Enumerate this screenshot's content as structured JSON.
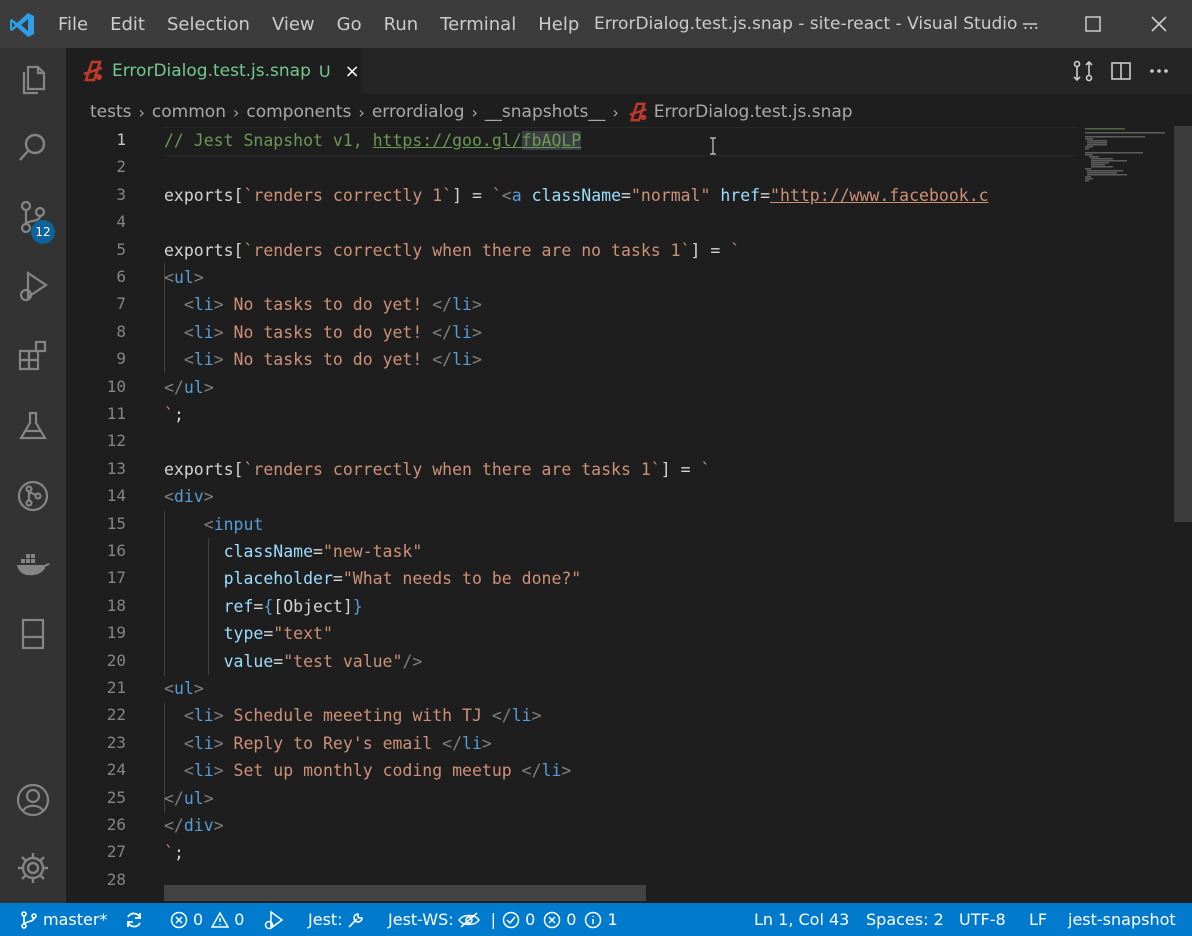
{
  "window": {
    "title": "ErrorDialog.test.js.snap - site-react - Visual Studio ...",
    "menu": [
      "File",
      "Edit",
      "Selection",
      "View",
      "Go",
      "Run",
      "Terminal",
      "Help"
    ]
  },
  "activity_bar": {
    "items": [
      "explorer-icon",
      "search-icon",
      "source-control-icon",
      "run-debug-icon",
      "extensions-icon",
      "testing-icon",
      "git-graph-icon",
      "docker-icon",
      "panel-icon"
    ],
    "source_control_badge": "12",
    "bottom": [
      "account-icon",
      "settings-gear-icon"
    ]
  },
  "tab": {
    "title": "ErrorDialog.test.js.snap",
    "status": "U",
    "close": "×"
  },
  "breadcrumbs": [
    "tests",
    "common",
    "components",
    "errordialog",
    "__snapshots__",
    "ErrorDialog.test.js.snap"
  ],
  "editor": {
    "active_line": 1,
    "line_numbers": [
      "1",
      "2",
      "3",
      "4",
      "5",
      "6",
      "7",
      "8",
      "9",
      "10",
      "11",
      "12",
      "13",
      "14",
      "15",
      "16",
      "17",
      "18",
      "19",
      "20",
      "21",
      "22",
      "23",
      "24",
      "25",
      "26",
      "27",
      "28"
    ],
    "lines": [
      {
        "n": 1,
        "tokens": [
          [
            "cm",
            "// Jest Snapshot v1, "
          ],
          [
            "cm lnk",
            "https://goo.gl/"
          ],
          [
            "cm lnk sel",
            "fbAQLP"
          ]
        ]
      },
      {
        "n": 2,
        "tokens": []
      },
      {
        "n": 3,
        "tokens": [
          [
            "",
            "exports["
          ],
          [
            "str",
            "`renders correctly 1`"
          ],
          [
            "",
            "] = "
          ],
          [
            "str",
            "`"
          ],
          [
            "br",
            "<"
          ],
          [
            "tg",
            "a"
          ],
          [
            "",
            ""
          ],
          [
            "at",
            " className"
          ],
          [
            "",
            "="
          ],
          [
            "str",
            "\"normal\""
          ],
          [
            "at",
            " href"
          ],
          [
            "",
            "="
          ],
          [
            "str lnk",
            "\"http://www.facebook.c"
          ]
        ]
      },
      {
        "n": 4,
        "tokens": []
      },
      {
        "n": 5,
        "tokens": [
          [
            "",
            "exports["
          ],
          [
            "str",
            "`renders correctly when there are no tasks 1`"
          ],
          [
            "",
            "] = "
          ],
          [
            "str",
            "`"
          ]
        ]
      },
      {
        "n": 6,
        "tokens": [
          [
            "br",
            "<"
          ],
          [
            "tg",
            "ul"
          ],
          [
            "br",
            ">"
          ]
        ]
      },
      {
        "n": 7,
        "tokens": [
          [
            "",
            "  "
          ],
          [
            "br",
            "<"
          ],
          [
            "tg",
            "li"
          ],
          [
            "br",
            ">"
          ],
          [
            "str",
            " No tasks to do yet! "
          ],
          [
            "br",
            "</"
          ],
          [
            "tg",
            "li"
          ],
          [
            "br",
            ">"
          ]
        ]
      },
      {
        "n": 8,
        "tokens": [
          [
            "",
            "  "
          ],
          [
            "br",
            "<"
          ],
          [
            "tg",
            "li"
          ],
          [
            "br",
            ">"
          ],
          [
            "str",
            " No tasks to do yet! "
          ],
          [
            "br",
            "</"
          ],
          [
            "tg",
            "li"
          ],
          [
            "br",
            ">"
          ]
        ]
      },
      {
        "n": 9,
        "tokens": [
          [
            "",
            "  "
          ],
          [
            "br",
            "<"
          ],
          [
            "tg",
            "li"
          ],
          [
            "br",
            ">"
          ],
          [
            "str",
            " No tasks to do yet! "
          ],
          [
            "br",
            "</"
          ],
          [
            "tg",
            "li"
          ],
          [
            "br",
            ">"
          ]
        ]
      },
      {
        "n": 10,
        "tokens": [
          [
            "br",
            "</"
          ],
          [
            "tg",
            "ul"
          ],
          [
            "br",
            ">"
          ]
        ]
      },
      {
        "n": 11,
        "tokens": [
          [
            "str",
            "`"
          ],
          [
            "",
            ";"
          ]
        ]
      },
      {
        "n": 12,
        "tokens": []
      },
      {
        "n": 13,
        "tokens": [
          [
            "",
            "exports["
          ],
          [
            "str",
            "`renders correctly when there are tasks 1`"
          ],
          [
            "",
            "] = "
          ],
          [
            "str",
            "`"
          ]
        ]
      },
      {
        "n": 14,
        "tokens": [
          [
            "br",
            "<"
          ],
          [
            "tg",
            "div"
          ],
          [
            "br",
            ">"
          ]
        ]
      },
      {
        "n": 15,
        "tokens": [
          [
            "",
            "    "
          ],
          [
            "br",
            "<"
          ],
          [
            "tg",
            "input"
          ]
        ]
      },
      {
        "n": 16,
        "tokens": [
          [
            "",
            "      "
          ],
          [
            "at",
            "className"
          ],
          [
            "",
            "="
          ],
          [
            "str",
            "\"new-task\""
          ]
        ]
      },
      {
        "n": 17,
        "tokens": [
          [
            "",
            "      "
          ],
          [
            "at",
            "placeholder"
          ],
          [
            "",
            "="
          ],
          [
            "str",
            "\"What needs to be done?\""
          ]
        ]
      },
      {
        "n": 18,
        "tokens": [
          [
            "",
            "      "
          ],
          [
            "at",
            "ref"
          ],
          [
            "",
            "="
          ],
          [
            "tg",
            "{"
          ],
          [
            "",
            "[Object]"
          ],
          [
            "tg",
            "}"
          ]
        ]
      },
      {
        "n": 19,
        "tokens": [
          [
            "",
            "      "
          ],
          [
            "at",
            "type"
          ],
          [
            "",
            "="
          ],
          [
            "str",
            "\"text\""
          ]
        ]
      },
      {
        "n": 20,
        "tokens": [
          [
            "",
            "      "
          ],
          [
            "at",
            "value"
          ],
          [
            "",
            "="
          ],
          [
            "str",
            "\"test value\""
          ],
          [
            "br",
            "/>"
          ]
        ]
      },
      {
        "n": 21,
        "tokens": [
          [
            "br",
            "<"
          ],
          [
            "tg",
            "ul"
          ],
          [
            "br",
            ">"
          ]
        ]
      },
      {
        "n": 22,
        "tokens": [
          [
            "",
            "  "
          ],
          [
            "br",
            "<"
          ],
          [
            "tg",
            "li"
          ],
          [
            "br",
            ">"
          ],
          [
            "str",
            " Schedule meeeting with TJ "
          ],
          [
            "br",
            "</"
          ],
          [
            "tg",
            "li"
          ],
          [
            "br",
            ">"
          ]
        ]
      },
      {
        "n": 23,
        "tokens": [
          [
            "",
            "  "
          ],
          [
            "br",
            "<"
          ],
          [
            "tg",
            "li"
          ],
          [
            "br",
            ">"
          ],
          [
            "str",
            " Reply to Rey's email "
          ],
          [
            "br",
            "</"
          ],
          [
            "tg",
            "li"
          ],
          [
            "br",
            ">"
          ]
        ]
      },
      {
        "n": 24,
        "tokens": [
          [
            "",
            "  "
          ],
          [
            "br",
            "<"
          ],
          [
            "tg",
            "li"
          ],
          [
            "br",
            ">"
          ],
          [
            "str",
            " Set up monthly coding meetup "
          ],
          [
            "br",
            "</"
          ],
          [
            "tg",
            "li"
          ],
          [
            "br",
            ">"
          ]
        ]
      },
      {
        "n": 25,
        "tokens": [
          [
            "br",
            "</"
          ],
          [
            "tg",
            "ul"
          ],
          [
            "br",
            ">"
          ]
        ]
      },
      {
        "n": 26,
        "tokens": [
          [
            "br",
            "</"
          ],
          [
            "tg",
            "div"
          ],
          [
            "br",
            ">"
          ]
        ]
      },
      {
        "n": 27,
        "tokens": [
          [
            "str",
            "`"
          ],
          [
            "",
            ";"
          ]
        ]
      },
      {
        "n": 28,
        "tokens": []
      }
    ]
  },
  "status_bar": {
    "branch": "master*",
    "errors": "0",
    "warnings": "0",
    "jest_label": "Jest:",
    "jest_ws_label": "Jest-WS:",
    "ws_passed": "0",
    "ws_failed": "0",
    "ws_skipped": "1",
    "cursor": "Ln 1, Col 43",
    "spaces": "Spaces: 2",
    "encoding": "UTF-8",
    "eol": "LF",
    "language": "jest-snapshot",
    "color": "#007acc"
  }
}
